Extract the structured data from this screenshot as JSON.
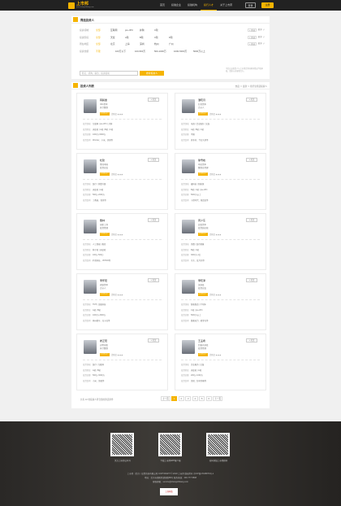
{
  "header": {
    "brand": "上市邦",
    "brand_sub": "www.shangshibang.com",
    "nav": [
      "首页",
      "投融企业",
      "投融机构",
      "投行人才",
      "关于上市邦"
    ],
    "login": "登录",
    "register": "注册"
  },
  "filter": {
    "title": "筛选投资人",
    "rows": [
      {
        "label": "投资领域",
        "opts": [
          "全部",
          "互联网",
          "pre-IPO",
          "并购",
          "C轮"
        ],
        "side": "+ 多选",
        "more": "更多 ∨"
      },
      {
        "label": "投资阶段",
        "opts": [
          "全部",
          "天使",
          "A轮",
          "B轮",
          "C轮",
          "D轮"
        ],
        "side": "+ 多选",
        "more": "更多 ∨"
      },
      {
        "label": "所在地区",
        "opts": [
          "全部",
          "北京",
          "上海",
          "深圳",
          "杭州",
          "广州"
        ],
        "side": "+ 多选",
        "more": "更多 ∨"
      },
      {
        "label": "投资金额",
        "opts": [
          "不限",
          "100万以下",
          "100-500万",
          "500-1000万",
          "1000-5000万",
          "5000万以上"
        ],
        "side": "",
        "more": ""
      }
    ],
    "search_placeholder": "姓名、机构、职位、投资领域",
    "search_btn": "搜索投资人",
    "tip": "平台认证投资人与上市邦合作机构均经过严格审核，请放心对接项目方。"
  },
  "list": {
    "title": "投资人列表",
    "sort": "热度 ∨ 最新 ∨ 按行业筛选投资人",
    "cards": [
      {
        "name": "韩毅章",
        "line1": "IDG资本",
        "line2": "执行董事",
        "badge": "认证投资人",
        "score": "活跃度 ★★★",
        "follow": "+ 关注",
        "fields": [
          [
            "投资领域",
            "互联网 | pre-IPO | 并购"
          ],
          [
            "投资阶段",
            "天使轮 | A轮 | B轮 | C轮"
          ],
          [
            "投资金额",
            "1000万-5000万"
          ],
          [
            "投资案例",
            "Wonder、小米、美团等"
          ]
        ]
      },
      {
        "name": "潘晓月",
        "line1": "红杉资本",
        "line2": "合伙人",
        "badge": "认证投资人",
        "score": "活跃度 ★★★",
        "follow": "+ 关注",
        "fields": [
          [
            "投资领域",
            "电商 | 企业服务 | 文娱"
          ],
          [
            "投资阶段",
            "A轮 | B轮 | C轮"
          ],
          [
            "投资金额",
            "不限"
          ],
          [
            "投资案例",
            "拼多多、今日头条等"
          ]
        ]
      },
      {
        "name": "杜建",
        "line1": "经纬中国",
        "line2": "投资总监",
        "badge": "认证投资人",
        "score": "活跃度 ★★★",
        "follow": "+ 关注",
        "fields": [
          [
            "投资领域",
            "医疗 | 消费升级"
          ],
          [
            "投资阶段",
            "天使轮 | A轮"
          ],
          [
            "投资金额",
            "500万-2000万"
          ],
          [
            "投资案例",
            "丁香园、喜茶等"
          ]
        ]
      },
      {
        "name": "徐雪峰",
        "line1": "中金资本",
        "line2": "董事总经理",
        "badge": "认证投资人",
        "score": "活跃度 ★★★",
        "follow": "+ 关注",
        "fields": [
          [
            "投资领域",
            "硬科技 | 新能源"
          ],
          [
            "投资阶段",
            "B轮 | C轮 | pre-IPO"
          ],
          [
            "投资金额",
            "5000万以上"
          ],
          [
            "投资案例",
            "宁德时代、寒武纪等"
          ]
        ]
      },
      {
        "name": "戴林",
        "line1": "创新工场",
        "line2": "投资经理",
        "badge": "认证投资人",
        "score": "活跃度 ★★★",
        "follow": "+ 关注",
        "fields": [
          [
            "投资领域",
            "人工智能 | 教育"
          ],
          [
            "投资阶段",
            "种子轮 | 天使轮"
          ],
          [
            "投资金额",
            "100万-500万"
          ],
          [
            "投资案例",
            "旷视科技、VIPKID等"
          ]
        ]
      },
      {
        "name": "周少东",
        "line1": "高瓴资本",
        "line2": "投资副总裁",
        "badge": "认证投资人",
        "score": "活跃度 ★★★",
        "follow": "+ 关注",
        "fields": [
          [
            "投资领域",
            "消费 | 医疗健康"
          ],
          [
            "投资阶段",
            "B轮 | C轮"
          ],
          [
            "投资金额",
            "3000万-1亿"
          ],
          [
            "投资案例",
            "京东、蓝月亮等"
          ]
        ]
      },
      {
        "name": "李怀阳",
        "line1": "君联资本",
        "line2": "合伙人",
        "badge": "认证投资人",
        "score": "活跃度 ★★★",
        "follow": "+ 关注",
        "fields": [
          [
            "投资领域",
            "TMT | 金融科技"
          ],
          [
            "投资阶段",
            "A轮 | B轮"
          ],
          [
            "投资金额",
            "1000万-3000万"
          ],
          [
            "投资案例",
            "神州租车、拉卡拉等"
          ]
        ]
      },
      {
        "name": "李晓泽",
        "line1": "深创投",
        "line2": "投资总监",
        "badge": "认证投资人",
        "score": "活跃度 ★★★",
        "follow": "+ 关注",
        "fields": [
          [
            "投资领域",
            "智能制造 | 半导体"
          ],
          [
            "投资阶段",
            "C轮 | pre-IPO"
          ],
          [
            "投资金额",
            "5000万以上"
          ],
          [
            "投资案例",
            "潍柴动力、欧菲光等"
          ]
        ]
      },
      {
        "name": "崔正阳",
        "line1": "启明创投",
        "line2": "执行董事",
        "badge": "认证投资人",
        "score": "活跃度 ★★★",
        "follow": "+ 关注",
        "fields": [
          [
            "投资领域",
            "医疗 | 互联网"
          ],
          [
            "投资阶段",
            "A轮 | B轮"
          ],
          [
            "投资金额",
            "500万-3000万"
          ],
          [
            "投资案例",
            "小米、美图等"
          ]
        ]
      },
      {
        "name": "王孟希",
        "line1": "北极光创投",
        "line2": "投资经理",
        "badge": "认证投资人",
        "score": "活跃度 ★★★",
        "follow": "+ 关注",
        "fields": [
          [
            "投资领域",
            "企业服务 | 文娱"
          ],
          [
            "投资阶段",
            "天使轮 | A轮"
          ],
          [
            "投资金额",
            "200万-1000万"
          ],
          [
            "投资案例",
            "美团、纷享销客等"
          ]
        ]
      }
    ],
    "note": "共有 10 位投资人符合您的筛选条件",
    "pager": [
      "上一页",
      "1",
      "2",
      "3",
      "4",
      "5",
      "6",
      "下一页"
    ]
  },
  "footer": {
    "qr_labels": [
      "关注上市邦公众号",
      "下载上市邦APP客户端",
      "扫码添加上市邦顾问"
    ],
    "lines": [
      "上市邦（北京）投资咨询有限公司 COPYRIGHT © 2018 上市邦 版权所有 京ICP备17028879号-1",
      "地址：北京市朝阳区建国路88号 服务热线：400-777-5808",
      "客服邮箱：service@shangshibang.com"
    ],
    "badge": "工商网监"
  }
}
